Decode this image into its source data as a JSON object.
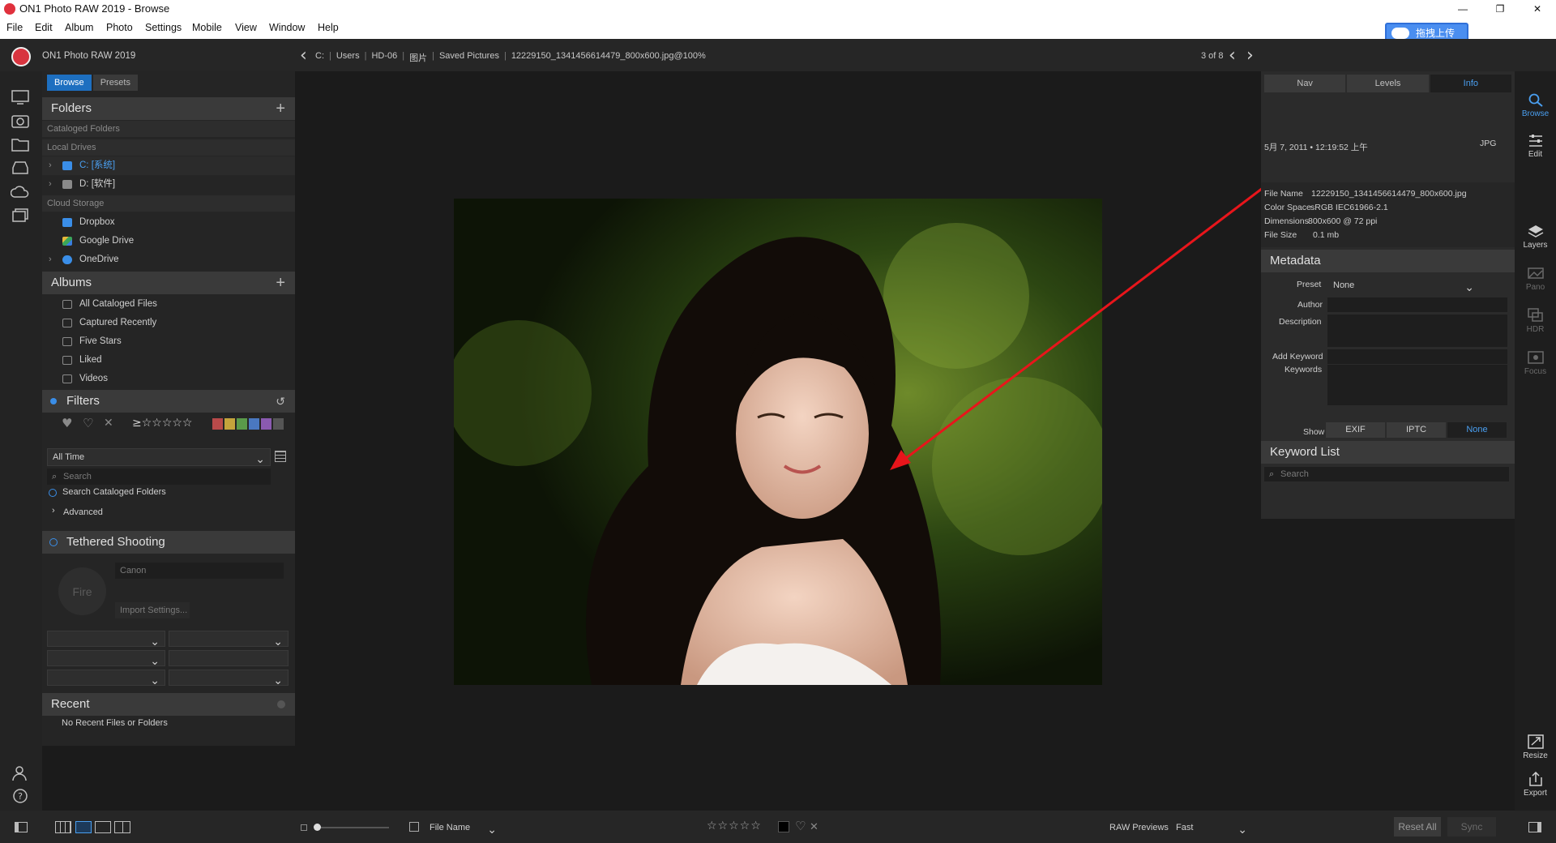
{
  "window": {
    "title": "ON1 Photo RAW 2019 - Browse"
  },
  "menu": [
    "File",
    "Edit",
    "Album",
    "Photo",
    "Settings",
    "Mobile",
    "View",
    "Window",
    "Help"
  ],
  "upload_button": "拖拽上传",
  "app": {
    "name": "ON1 Photo RAW 2019"
  },
  "breadcrumb": [
    "C:",
    "Users",
    "HD-06",
    "图片",
    "Saved Pictures",
    "12229150_1341456614479_800x600.jpg@100%"
  ],
  "counter": "3 of 8",
  "left_tabs": {
    "browse": "Browse",
    "presets": "Presets"
  },
  "folders": {
    "title": "Folders",
    "cataloged_label": "Cataloged Folders",
    "local_label": "Local Drives",
    "drives": [
      "C: [系统]",
      "D: [软件]"
    ],
    "cloud_label": "Cloud Storage",
    "cloud": [
      "Dropbox",
      "Google Drive",
      "OneDrive"
    ]
  },
  "albums": {
    "title": "Albums",
    "items": [
      "All Cataloged Files",
      "Captured Recently",
      "Five Stars",
      "Liked",
      "Videos"
    ]
  },
  "filters": {
    "title": "Filters",
    "stars": "≥☆☆☆☆☆",
    "time": "All Time",
    "search_placeholder": "Search",
    "search_cataloged": "Search Cataloged Folders",
    "advanced": "Advanced",
    "color_labels": [
      "#b84a4a",
      "#c4a43c",
      "#5a9a4a",
      "#4a78c0",
      "#8a5ab0",
      "#555555"
    ]
  },
  "tethered": {
    "title": "Tethered Shooting",
    "camera_placeholder": "Canon",
    "fire": "Fire",
    "import_settings": "Import Settings..."
  },
  "recent": {
    "title": "Recent",
    "empty": "No Recent Files or Folders"
  },
  "right_tabs": [
    "Nav",
    "Levels",
    "Info"
  ],
  "info": {
    "date": "5月 7, 2011 • 12:19:52 上午",
    "format": "JPG",
    "file_name_label": "File Name",
    "file_name": "12229150_1341456614479_800x600.jpg",
    "color_space_label": "Color Space",
    "color_space": "sRGB IEC61966-2.1",
    "dimensions_label": "Dimensions",
    "dimensions": "800x600 @ 72 ppi",
    "file_size_label": "File Size",
    "file_size": "0.1 mb"
  },
  "metadata": {
    "title": "Metadata",
    "preset_label": "Preset",
    "preset_value": "None",
    "author_label": "Author",
    "description_label": "Description",
    "add_keyword_label": "Add Keyword",
    "keywords_label": "Keywords",
    "show_label": "Show",
    "show_tabs": [
      "EXIF",
      "IPTC",
      "None"
    ]
  },
  "keyword_list": {
    "title": "Keyword List",
    "search_placeholder": "Search"
  },
  "right_rail": [
    "Browse",
    "Edit",
    "Layers",
    "Pano",
    "HDR",
    "Focus",
    "Resize",
    "Export"
  ],
  "footer": {
    "sort": "File Name",
    "rating_stars": "☆☆☆☆☆",
    "raw_previews_label": "RAW Previews",
    "raw_previews_value": "Fast",
    "reset_all": "Reset All",
    "sync": "Sync"
  }
}
